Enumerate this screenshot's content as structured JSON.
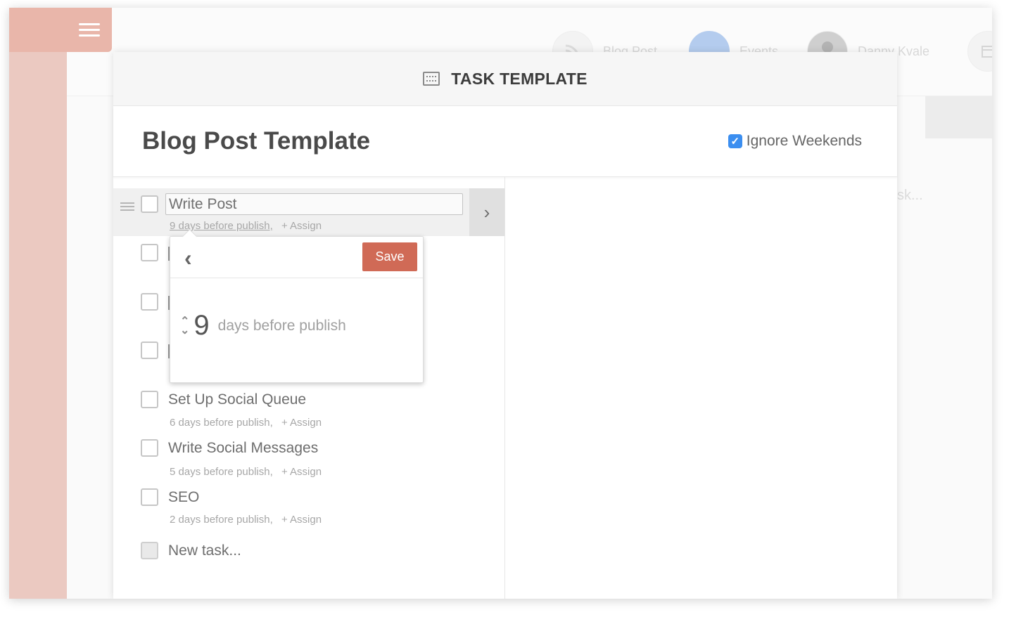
{
  "background_app": {
    "nav": [
      {
        "label": "Blog Post",
        "icon": "rss-icon"
      },
      {
        "label": "Events",
        "icon": "events-icon"
      },
      {
        "label": "Danny Kvale",
        "icon": "avatar-icon"
      }
    ],
    "ghost_text": "sk..."
  },
  "modal": {
    "header_title": "TASK TEMPLATE",
    "header_icon": "template-icon",
    "template_name": "Blog Post Template",
    "ignore_weekends": {
      "label": "Ignore Weekends",
      "checked": true
    },
    "tasks": [
      {
        "name": "Write Post",
        "due": "9 days before publish,",
        "assign": "+ Assign",
        "active": true
      },
      {
        "name": "Set Up Social Queue",
        "due": "6 days before publish,",
        "assign": "+ Assign"
      },
      {
        "name": "Write Social Messages",
        "due": "5 days before publish,",
        "assign": "+ Assign"
      },
      {
        "name": "SEO",
        "due": "2 days before publish,",
        "assign": "+ Assign"
      }
    ],
    "new_task_placeholder": "New task..."
  },
  "popover": {
    "save_label": "Save",
    "value": "9",
    "suffix": "days before publish"
  },
  "colors": {
    "sidebar": "#ebc9c1",
    "save": "#d06a56",
    "checkbox_accent": "#3b8ef0",
    "events_circle": "#b4ccee"
  }
}
